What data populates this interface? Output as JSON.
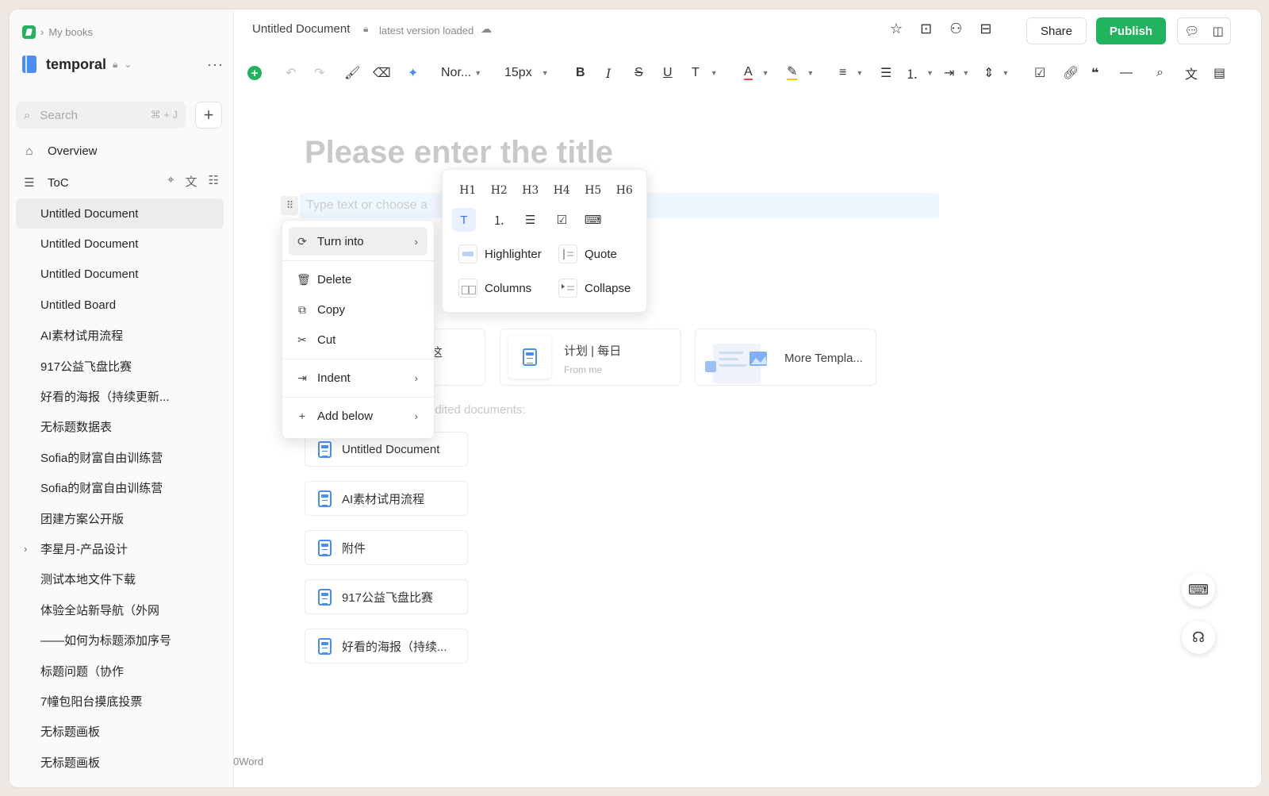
{
  "breadcrumb": {
    "parent": "My books"
  },
  "book": {
    "title": "temporal"
  },
  "search": {
    "placeholder": "Search",
    "shortcut": "⌘ + J"
  },
  "nav": {
    "overview": "Overview",
    "toc": "ToC"
  },
  "toc_items": [
    {
      "label": "Untitled Document",
      "active": true
    },
    {
      "label": "Untitled Document"
    },
    {
      "label": "Untitled Document"
    },
    {
      "label": "Untitled Board"
    },
    {
      "label": "AI素材试用流程"
    },
    {
      "label": "917公益飞盘比赛"
    },
    {
      "label": "好看的海报（持续更新..."
    },
    {
      "label": "无标题数据表"
    },
    {
      "label": "Sofia的财富自由训练营"
    },
    {
      "label": "Sofia的财富自由训练营"
    },
    {
      "label": "团建方案公开版"
    },
    {
      "label": "李星月-产品设计",
      "expandable": true
    },
    {
      "label": "测试本地文件下载"
    },
    {
      "label": "体验全站新导航（外网"
    },
    {
      "label": "——如何为标题添加序号"
    },
    {
      "label": "标题问题（协作"
    },
    {
      "label": "7幢包阳台摸底投票"
    },
    {
      "label": "无标题画板"
    },
    {
      "label": "无标题画板"
    }
  ],
  "header": {
    "doc_title": "Untitled Document",
    "status": "latest version loaded",
    "share": "Share",
    "publish": "Publish"
  },
  "toolbar": {
    "style": "Nor...",
    "font_size": "15px"
  },
  "editor": {
    "title_placeholder": "Please enter the title",
    "para_placeholder": "Type text or choose a",
    "recent_label": "edited documents:",
    "word_count": "0Word"
  },
  "templates": [
    {
      "title": "计划 | 每日",
      "sub": "From me"
    },
    {
      "title": "More Templa..."
    }
  ],
  "template_partial": "这",
  "recent_docs": [
    "Untitled Document",
    "AI素材试用流程",
    "附件",
    "917公益飞盘比赛",
    "好看的海报（持续..."
  ],
  "context_menu": {
    "turn_into": "Turn into",
    "delete": "Delete",
    "copy": "Copy",
    "cut": "Cut",
    "indent": "Indent",
    "add_below": "Add below"
  },
  "turn_into_menu": {
    "headings": [
      "H1",
      "H2",
      "H3",
      "H4",
      "H5",
      "H6"
    ],
    "blocks": {
      "highlighter": "Highlighter",
      "quote": "Quote",
      "columns": "Columns",
      "collapse": "Collapse"
    }
  },
  "colors": {
    "brand": "#22b35e",
    "accent": "#2f75e8",
    "book": "#4b8ef2"
  }
}
